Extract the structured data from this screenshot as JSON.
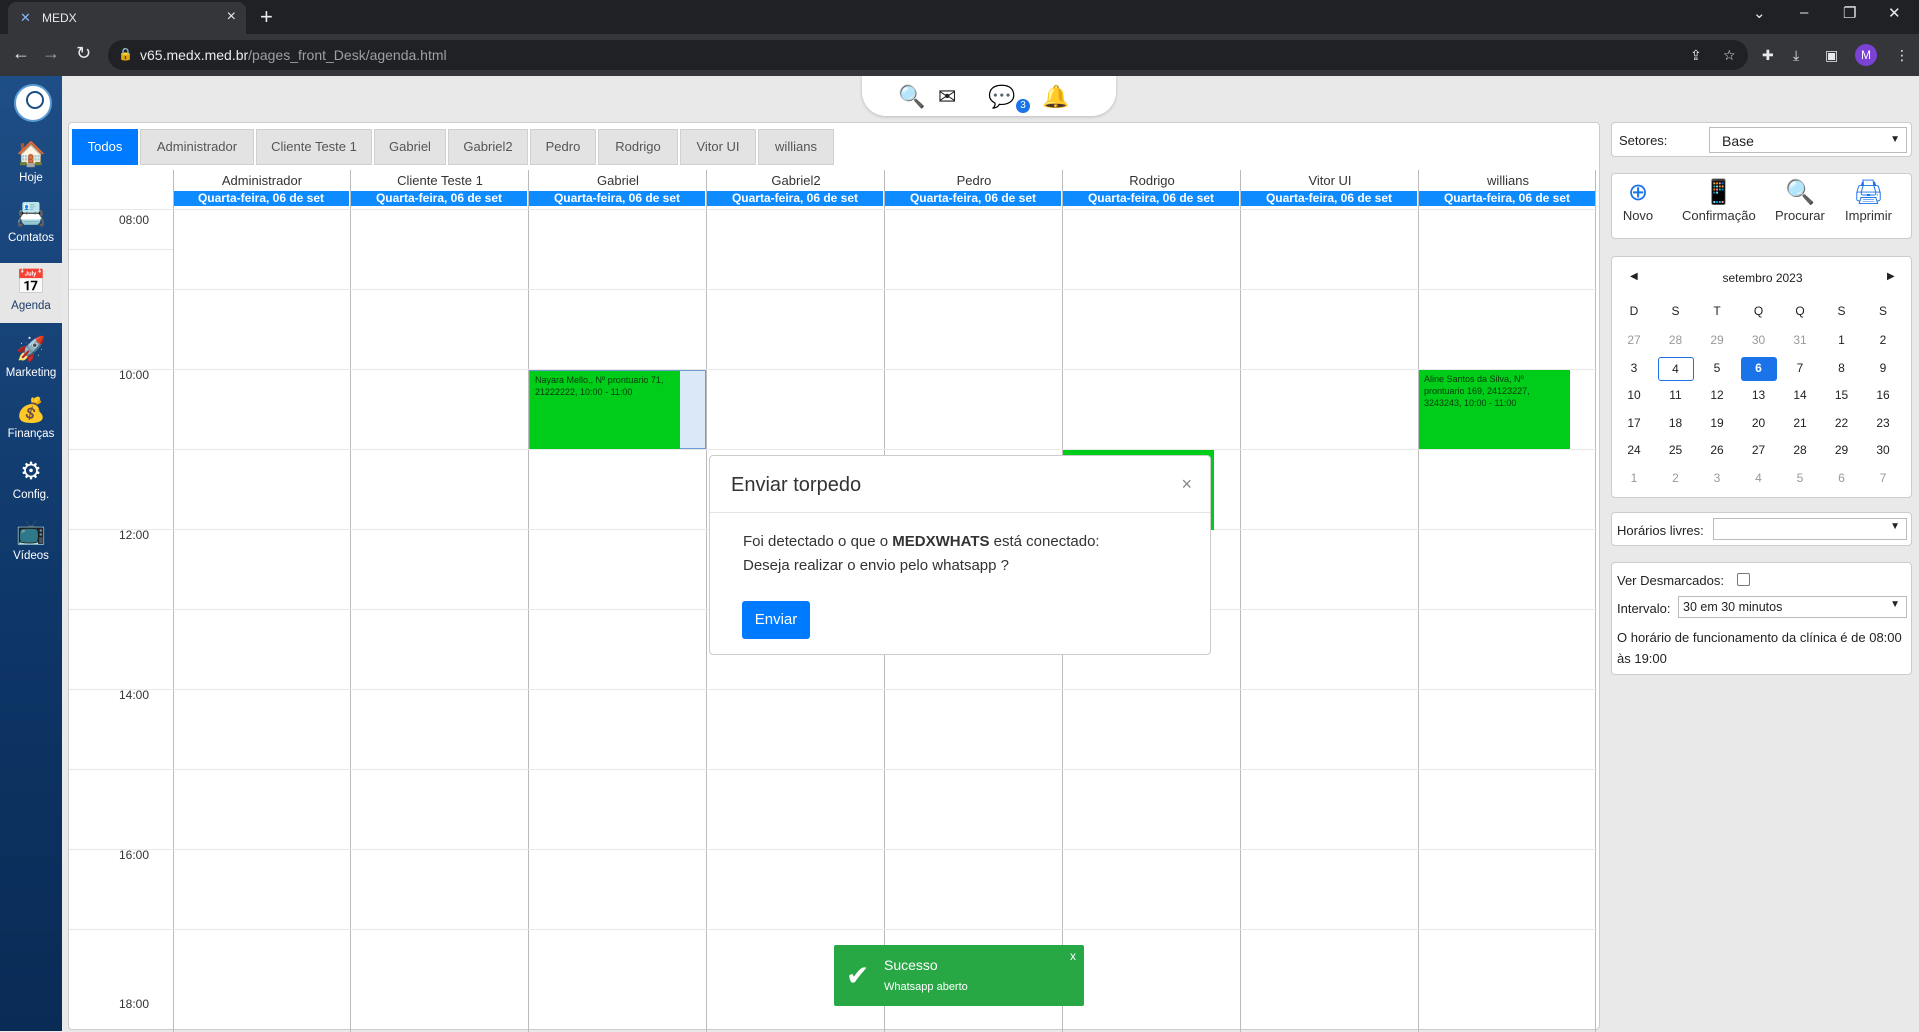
{
  "browser": {
    "tab_title": "MEDX",
    "url_host": "v65.medx.med.br",
    "url_path": "/pages_front_Desk/agenda.html",
    "profile_letter": "M"
  },
  "sidebar": {
    "items": [
      {
        "label": "Hoje",
        "icon": "home-icon"
      },
      {
        "label": "Contatos",
        "icon": "contacts-icon"
      },
      {
        "label": "Agenda",
        "icon": "calendar-icon"
      },
      {
        "label": "Marketing",
        "icon": "rocket-icon"
      },
      {
        "label": "Finanças",
        "icon": "money-icon"
      },
      {
        "label": "Config.",
        "icon": "gear-icon"
      },
      {
        "label": "Vídeos",
        "icon": "video-icon"
      }
    ]
  },
  "topbar": {
    "chat_badge": "3"
  },
  "agenda": {
    "tabs": [
      "Todos",
      "Administrador",
      "Cliente Teste 1",
      "Gabriel",
      "Gabriel2",
      "Pedro",
      "Rodrigo",
      "Vitor UI",
      "willians"
    ],
    "columns": [
      "Administrador",
      "Cliente Teste 1",
      "Gabriel",
      "Gabriel2",
      "Pedro",
      "Rodrigo",
      "Vitor UI",
      "willians"
    ],
    "date_label": "Quarta-feira, 06 de set",
    "times": [
      "08:00",
      "10:00",
      "12:00",
      "14:00",
      "16:00",
      "18:00"
    ],
    "events": [
      {
        "column": "Gabriel",
        "text": "Nayara Mello,, Nº prontuario 71, 21222222, 10:00 - 11:00"
      },
      {
        "column": "willians",
        "text": "Aline Santos da Silva, Nº prontuario 169, 24123227, 3243243, 10:00 - 11:00"
      }
    ]
  },
  "modal": {
    "title": "Enviar torpedo",
    "line1_pre": "Foi detectado o que o ",
    "line1_bold": "MEDXWHATS",
    "line1_post": " está conectado:",
    "line2": "Deseja realizar o envio pelo whatsapp ?",
    "send_label": "Enviar",
    "close": "×"
  },
  "toast": {
    "title": "Sucesso",
    "message": "Whatsapp aberto",
    "close": "x"
  },
  "right": {
    "setores_label": "Setores:",
    "setores_value": "Base",
    "actions": [
      {
        "label": "Novo",
        "icon": "plus-circle-icon"
      },
      {
        "label": "Confirmação",
        "icon": "phone-confirm-icon"
      },
      {
        "label": "Procurar",
        "icon": "search-icon"
      },
      {
        "label": "Imprimir",
        "icon": "printer-icon"
      }
    ],
    "calendar": {
      "month": "setembro 2023",
      "weekdays": [
        "D",
        "S",
        "T",
        "Q",
        "Q",
        "S",
        "S"
      ],
      "weeks": [
        [
          "27",
          "28",
          "29",
          "30",
          "31",
          "1",
          "2"
        ],
        [
          "3",
          "4",
          "5",
          "6",
          "7",
          "8",
          "9"
        ],
        [
          "10",
          "11",
          "12",
          "13",
          "14",
          "15",
          "16"
        ],
        [
          "17",
          "18",
          "19",
          "20",
          "21",
          "22",
          "23"
        ],
        [
          "24",
          "25",
          "26",
          "27",
          "28",
          "29",
          "30"
        ],
        [
          "1",
          "2",
          "3",
          "4",
          "5",
          "6",
          "7"
        ]
      ],
      "today": "4",
      "selected": "6"
    },
    "horarios_label": "Horários livres:",
    "desmarcados_label": "Ver Desmarcados:",
    "intervalo_label": "Intervalo:",
    "intervalo_value": "30 em 30 minutos",
    "info": "O horário de funcionamento da clínica é de 08:00 às 19:00"
  }
}
